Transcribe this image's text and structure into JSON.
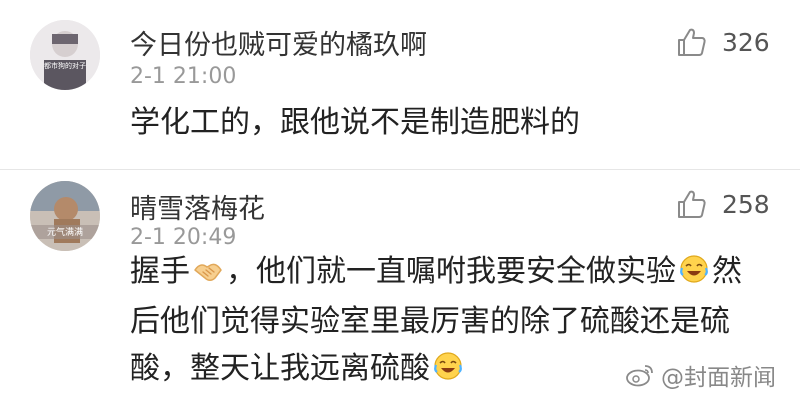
{
  "comments": [
    {
      "username": "今日份也贼可爱的橘玖啊",
      "time": "2-1 21:00",
      "likes": "326",
      "text": "学化工的，跟他说不是制造肥料的",
      "avatar_caption": "都市狗的对子"
    },
    {
      "username": "晴雪落梅花",
      "time": "2-1 20:49",
      "likes": "258",
      "text_a": "握手",
      "text_b": "，他们就一直嘱咐我要安全做实验",
      "text_c": "然后他们觉得实验室里最厉害的除了硫酸还是硫酸，整天让我远离硫酸",
      "avatar_caption": "元气满满"
    }
  ],
  "watermark": {
    "text": "@封面新闻"
  },
  "icons": {
    "like": "thumbs-up-icon",
    "handshake": "handshake-emoji-icon",
    "laugh": "laughing-emoji-icon",
    "weibo": "weibo-logo-icon"
  },
  "colors": {
    "name": "#333333",
    "time": "#999999",
    "text": "#222222",
    "icon": "#8a8a8a"
  }
}
